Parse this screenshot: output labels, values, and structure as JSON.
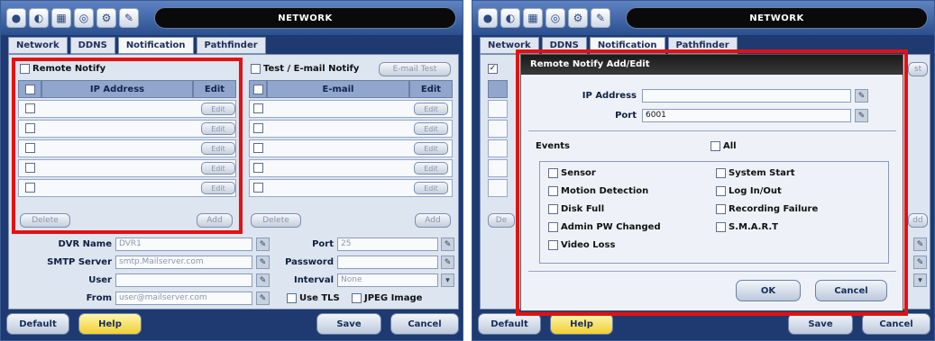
{
  "title": "NETWORK",
  "tabs": [
    "Network",
    "DDNS",
    "Notification",
    "Pathfinder"
  ],
  "left": {
    "remote_notify": "Remote Notify",
    "ip_header": "IP Address",
    "edit_header": "Edit",
    "email_notify": "Test / E-mail Notify",
    "email_test": "E-mail Test",
    "email_header": "E-mail",
    "edit_btn": "Edit",
    "delete": "Delete",
    "add": "Add",
    "dvr_name_label": "DVR Name",
    "dvr_name": "DVR1",
    "smtp_label": "SMTP Server",
    "smtp": "smtp.Mailserver.com",
    "user_label": "User",
    "user": "",
    "from_label": "From",
    "from": "user@mailserver.com",
    "port_label": "Port",
    "port": "25",
    "password_label": "Password",
    "password": "",
    "interval_label": "Interval",
    "interval": "None",
    "use_tls": "Use TLS",
    "jpeg": "JPEG Image"
  },
  "buttons": {
    "default": "Default",
    "help": "Help",
    "save": "Save",
    "cancel": "Cancel"
  },
  "dialog": {
    "title": "Remote Notify Add/Edit",
    "ip_label": "IP Address",
    "ip": "",
    "port_label": "Port",
    "port": "6001",
    "events_label": "Events",
    "all": "All",
    "events": [
      "Sensor",
      "Motion Detection",
      "Disk Full",
      "Admin PW Changed",
      "Video Loss",
      "System Start",
      "Log In/Out",
      "Recording Failure",
      "S.M.A.R.T"
    ],
    "ok": "OK",
    "cancel": "Cancel"
  },
  "right_bg": {
    "delete": "De",
    "set": "st",
    "add": "dd"
  },
  "highlight": "#e41111"
}
